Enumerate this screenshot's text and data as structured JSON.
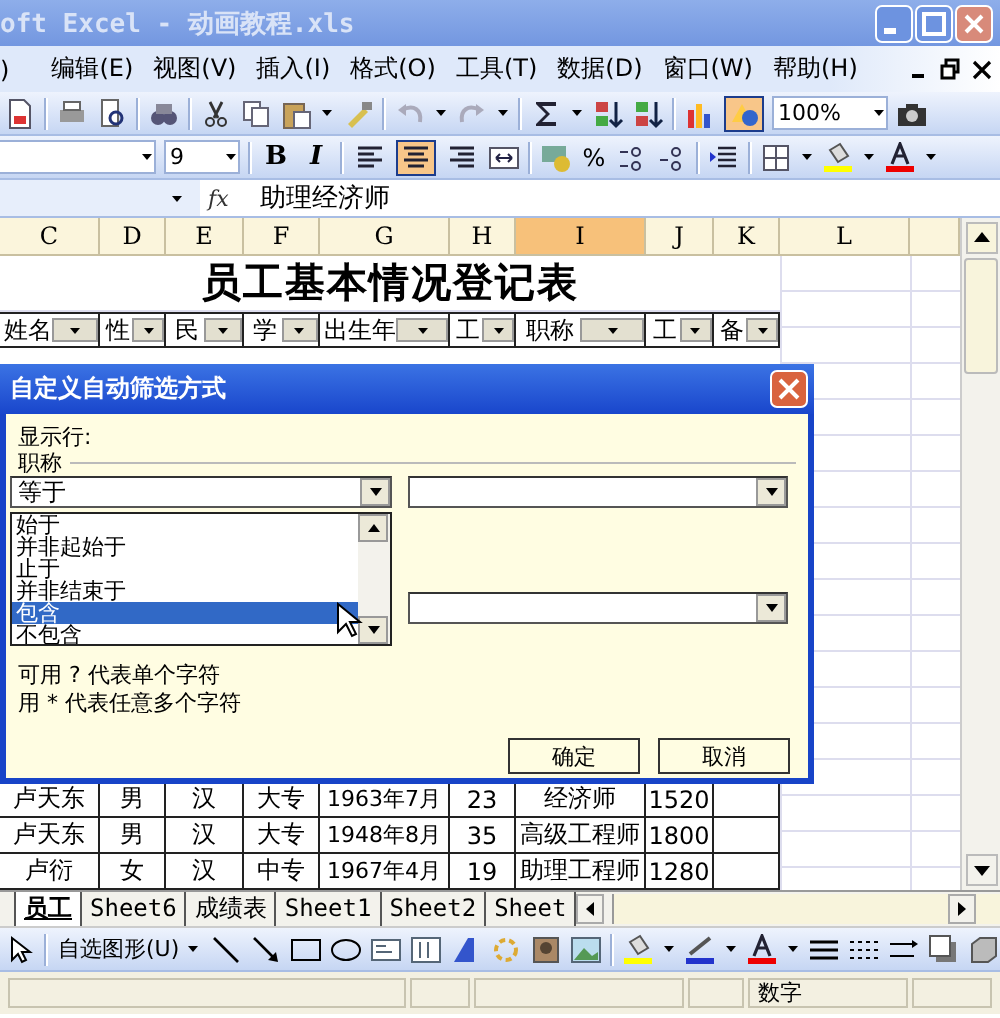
{
  "window": {
    "title": "oft Excel - 动画教程.xls"
  },
  "menu_bar": {
    "items": [
      ")",
      "编辑(E)",
      "视图(V)",
      "插入(I)",
      "格式(O)",
      "工具(T)",
      "数据(D)",
      "窗口(W)",
      "帮助(H)"
    ]
  },
  "standard_toolbar": {
    "drawing_button_pressed": true,
    "zoom": "100%"
  },
  "formatting_toolbar": {
    "font_size": "9",
    "bold": "B",
    "italic": "I",
    "percent": "%",
    "alignment_buttons": [
      {
        "selected": false
      },
      {
        "selected": true
      },
      {
        "selected": false
      }
    ]
  },
  "formula_bar": {
    "fx": "fx",
    "content": "助理经济师"
  },
  "sheet": {
    "columns": [
      {
        "label": "C",
        "selected": false
      },
      {
        "label": "D",
        "selected": false
      },
      {
        "label": "E",
        "selected": false
      },
      {
        "label": "F",
        "selected": false
      },
      {
        "label": "G",
        "selected": false
      },
      {
        "label": "H",
        "selected": false
      },
      {
        "label": "I",
        "selected": true
      },
      {
        "label": "J",
        "selected": false
      },
      {
        "label": "K",
        "selected": false
      },
      {
        "label": "L",
        "selected": false
      }
    ],
    "title": "员工基本情况登记表",
    "headers": [
      "姓名",
      "性",
      "民",
      "学",
      "出生年",
      "工",
      "职称",
      "工",
      "备"
    ],
    "rows": [
      [
        "卢天东",
        "男",
        "汉",
        "大专",
        "1963年7月",
        "23",
        "经济师",
        "1520"
      ],
      [
        "卢天东",
        "男",
        "汉",
        "大专",
        "1948年8月",
        "35",
        "高级工程师",
        "1800"
      ],
      [
        "卢衍",
        "女",
        "汉",
        "中专",
        "1967年4月",
        "19",
        "助理工程师",
        "1280"
      ]
    ]
  },
  "dialog": {
    "title": "自定义自动筛选方式",
    "show_rows_label": "显示行:",
    "field_label": "职称",
    "condition_1": "等于",
    "options": [
      {
        "label": "始于",
        "selected": false
      },
      {
        "label": "并非起始于",
        "selected": false
      },
      {
        "label": "止于",
        "selected": false
      },
      {
        "label": "并非结束于",
        "selected": false
      },
      {
        "label": "包含",
        "selected": true
      },
      {
        "label": "不包含",
        "selected": false
      }
    ],
    "hints": [
      "可用 ? 代表单个字符",
      "用 * 代表任意多个字符"
    ],
    "buttons": [
      "确定",
      "取消"
    ]
  },
  "sheet_tabs": [
    {
      "label": "员工",
      "selected": true
    },
    {
      "label": "Sheet6",
      "selected": false
    },
    {
      "label": "成绩表",
      "selected": false
    },
    {
      "label": "Sheet1",
      "selected": false
    },
    {
      "label": "Sheet2",
      "selected": false
    },
    {
      "label": "Sheet",
      "selected": false
    }
  ],
  "drawing_toolbar": {
    "autoshapes": "自选图形(U)"
  },
  "status_bar": {
    "mode": "数字"
  }
}
